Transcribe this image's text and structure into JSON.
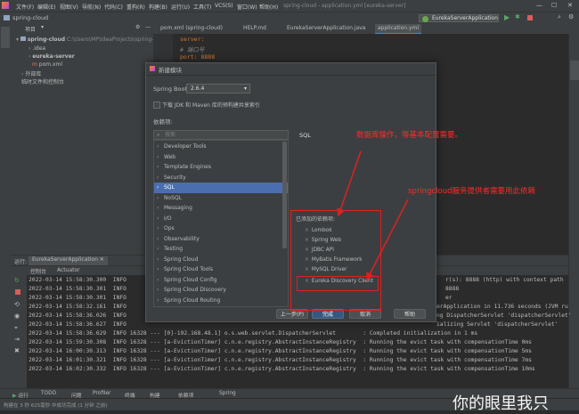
{
  "menubar": {
    "items": [
      "文件(F)",
      "编辑(E)",
      "视图(V)",
      "导航(N)",
      "代码(C)",
      "重构(R)",
      "构建(B)",
      "运行(U)",
      "工具(T)",
      "VCS(S)",
      "窗口(W)",
      "帮助(H)"
    ],
    "window_title": "spring-cloud - application.yml [eureka-server]"
  },
  "navbar": {
    "project_name": "spring-cloud",
    "run_config": "EurekaServerApplication"
  },
  "editor_tabs": [
    "pom.xml (spring-cloud)",
    "HELP.md",
    "EurekaServerApplication.java",
    "application.yml"
  ],
  "project_panel": {
    "header": "项目",
    "root": "spring-cloud",
    "root_path": "C:\\Users\\MP\\IdeaProjects\\spring-cloud",
    "children": [
      ".idea",
      "eureka-server",
      "pom.xml"
    ],
    "external_libs": "外部库",
    "scratches": "临时文件和控制台"
  },
  "editor": {
    "lines": [
      "server:",
      "  # 端口号",
      "  port: 8888"
    ]
  },
  "dialog": {
    "title": "新建模块",
    "spring_boot_label": "Spring Boot:",
    "spring_boot_version": "2.6.4",
    "download_checkbox": "下载 JDK 和 Maven 库的预构建共享索引",
    "deps_label": "依赖项:",
    "search_placeholder": "搜索",
    "categories": [
      "Developer Tools",
      "Web",
      "Template Engines",
      "Security",
      "SQL",
      "NoSQL",
      "Messaging",
      "I/O",
      "Ops",
      "Observability",
      "Testing",
      "Spring Cloud",
      "Spring Cloud Tools",
      "Spring Cloud Config",
      "Spring Cloud Discovery",
      "Spring Cloud Routing"
    ],
    "selected_category": "SQL",
    "detail_title": "SQL",
    "added_label": "已添加的依赖项:",
    "added_deps": [
      "Lombok",
      "Spring Web",
      "JDBC API",
      "MyBatis Framework",
      "MySQL Driver",
      "Eureka Discovery Client"
    ],
    "buttons": {
      "prev": "上一步(P)",
      "finish": "完成",
      "cancel": "取消",
      "help": "帮助"
    }
  },
  "run_panel": {
    "tab_label": "运行:",
    "config_name": "EurekaServerApplication",
    "sub_tabs": [
      "控制台",
      "Actuator"
    ],
    "log_lines": [
      "2022-03-14 15:58:30.300  INFO",
      "2022-03-14 15:58:30.301  INFO",
      "2022-03-14 15:58:30.301  INFO",
      "2022-03-14 15:58:32.161  INFO",
      "2022-03-14 15:58:36.026  INFO",
      "2022-03-14 15:58:36.627  INFO",
      "2022-03-14 15:58:36.629  INFO 16328 --- [0]-192.168.48.1] o.s.web.servlet.DispatcherServlet        : Completed initialization in 1 ms",
      "2022-03-14 15:59:30.308  INFO 16328 --- [a-EvictionTimer] c.n.e.registry.AbstractInstanceRegistry  : Running the evict task with compensationTime 0ms",
      "2022-03-14 16:00:30.313  INFO 16328 --- [a-EvictionTimer] c.n.e.registry.AbstractInstanceRegistry  : Running the evict task with compensationTime 5ms",
      "2022-03-14 16:01:30.321  INFO 16328 --- [a-EvictionTimer] c.n.e.registry.AbstractInstanceRegistry  : Running the evict task with compensationTime 7ms",
      "2022-03-14 16:02:30.332  INFO 16328 --- [a-EvictionTimer] c.n.e.registry.AbstractInstanceRegistry  : Running the evict task with compensationTime 10ms"
    ],
    "right_overflow": [
      "r(s): 8888 (http) with context path",
      "8888",
      "er",
      "erApplication in 11.736 seconds (JVM ru",
      "ng DispatcherServlet 'dispatcherServlet'",
      "ializing Servlet 'dispatcherServlet'"
    ]
  },
  "bottombar": {
    "items": [
      "运行",
      "TODO",
      "问题",
      "Profiler",
      "终端",
      "构建",
      "依赖项",
      "Spring"
    ]
  },
  "statusbar": {
    "text": "构建在 3 秒 625毫秒 中成功完成 (1 分钟 之前)"
  },
  "annotations": {
    "note1": "数据库操作，等基本配置需要。",
    "note2": "springcloud服务提供者需要用此依赖"
  },
  "watermark": "你的眼里我只"
}
